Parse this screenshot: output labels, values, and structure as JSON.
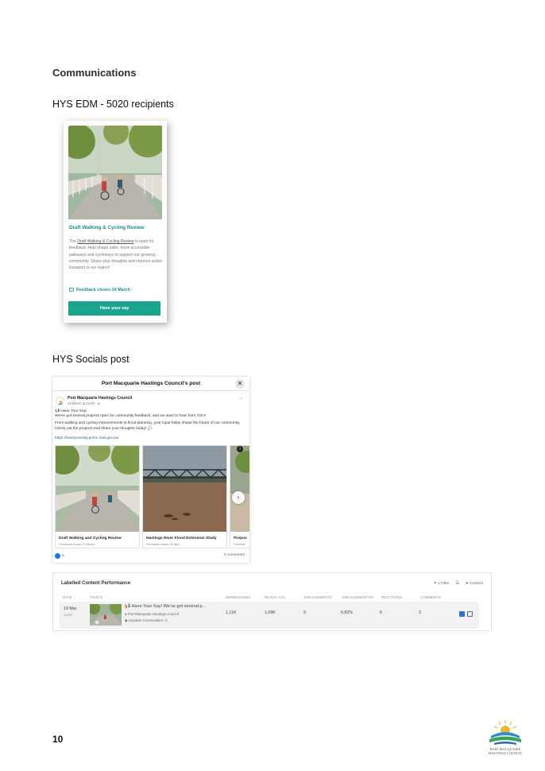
{
  "heading": "Communications",
  "edm_label": "HYS EDM - 5020 recipients",
  "edm": {
    "title": "Draft Walking & Cycling Review",
    "body_prefix": "The ",
    "body_link": "Draft Walking & Cycling Review",
    "body_suffix": " is open for feedback! Help shape safer, more accessible pathways and cycleways to support our growing community. Share your thoughts and improve active transport in our region!",
    "closes": "Feedback closes 24 March",
    "button": "Have your say"
  },
  "socials_label": "HYS Socials post",
  "fb": {
    "header": "Port Macquarie Hastings Council's post",
    "page_name": "Port Macquarie Hastings Council",
    "date": "19 March at 12:00 · ",
    "line1": "📢 Have Your Say!",
    "line2": "We've got several projects open for community feedback, and we want to hear from YOU!",
    "line3": "From walking and cycling improvements to flood planning, your input helps shape the future of our community. Check out the projects and share your thoughts today! 💬",
    "url": "https://haveyoursay.pmhc.nsw.gov.au/",
    "tiles": [
      {
        "caption": "Draft Walking and Cycling Review",
        "sub": "Feedback closes 24 March"
      },
      {
        "caption": "Hastings River Flood Extension Study",
        "sub": "Feedback closes 28 April"
      },
      {
        "caption": "Propos",
        "sub": "Feedbac"
      }
    ],
    "reactions": "6",
    "comments": "3 comments"
  },
  "perf": {
    "title": "Labelled Content Performance",
    "filter": "1 Filter",
    "content": "Content",
    "headers": {
      "date": "DATE ↓",
      "posts": "POSTS",
      "impressions": "IMPRESSIONS",
      "reach": "REACH AVG.",
      "engagements": "ENGAGEMENTS",
      "eng_rate": "ENGAGEMENT RA",
      "reactions": "REACTIONS",
      "comments": "COMMENTS"
    },
    "row": {
      "date": "19 Mar",
      "time": "12:00",
      "post": "📢 Have Your Say! We've got several p...",
      "page": "Port Macquarie Hastings Council",
      "label": "Liveable Communities +1",
      "impressions": "1,11K",
      "reach": "1,09K",
      "engagements": "9",
      "eng_rate": "0,82%",
      "reactions": "6",
      "comments": "3"
    }
  },
  "page_number": "10",
  "logo_text_1": "PORT MACQUARIE",
  "logo_text_2": "HASTINGS COUNCIL"
}
